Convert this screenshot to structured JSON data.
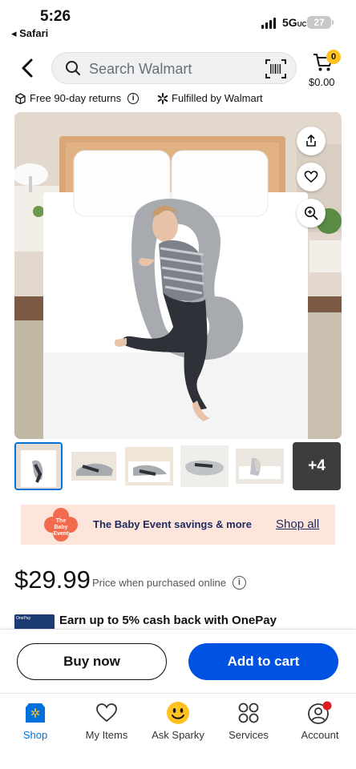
{
  "status_bar": {
    "time": "5:26",
    "back_app": "◂ Safari",
    "network": "5G",
    "network_suffix": "UC",
    "battery": "27"
  },
  "header": {
    "search_placeholder": "Search Walmart",
    "cart_count": "0",
    "cart_total": "$0.00"
  },
  "benefits": [
    {
      "label": "Free 90-day returns",
      "icon": "return-box-icon"
    },
    {
      "label": "Fulfilled by Walmart",
      "icon": "spark-icon"
    }
  ],
  "gallery": {
    "more_count": "+4",
    "thumbnail_count": 6,
    "active_index": 0
  },
  "promo": {
    "logo_text": "The Baby Event",
    "title": "The Baby Event savings & more",
    "link": "Shop all"
  },
  "product": {
    "price": "$29.99",
    "price_note": "Price when purchased online"
  },
  "onepay": {
    "card_label": "OnePay",
    "text": "Earn up to 5% cash back with OnePay"
  },
  "actions": {
    "buy_now": "Buy now",
    "add_to_cart": "Add to cart"
  },
  "nav": [
    {
      "label": "Shop",
      "icon": "shop-icon",
      "active": true
    },
    {
      "label": "My Items",
      "icon": "heart-icon"
    },
    {
      "label": "Ask Sparky",
      "icon": "sparky-icon"
    },
    {
      "label": "Services",
      "icon": "services-icon"
    },
    {
      "label": "Account",
      "icon": "account-icon"
    }
  ],
  "colors": {
    "primary_blue": "#0053e2",
    "walmart_blue": "#0071dc",
    "spark_yellow": "#ffc220",
    "promo_bg": "#fde5dc",
    "promo_flower": "#f26b4f"
  }
}
